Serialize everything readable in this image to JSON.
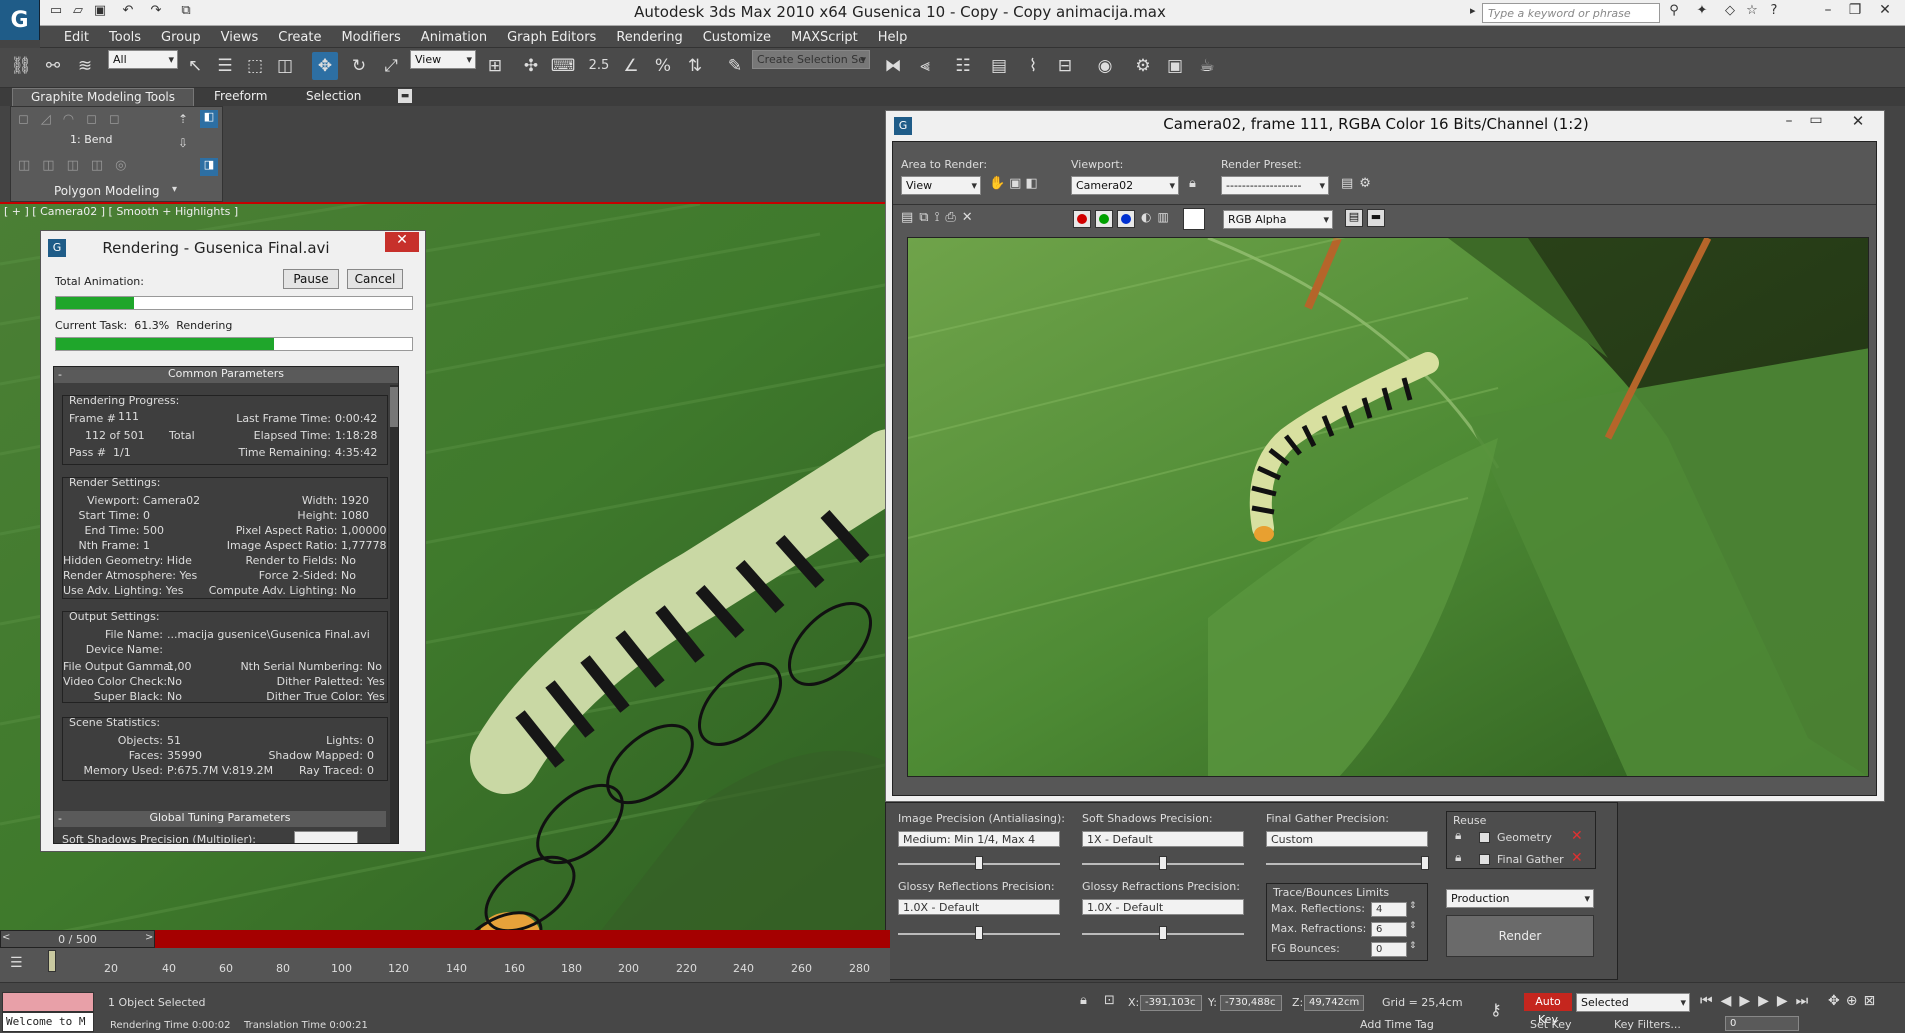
{
  "app": {
    "title": "Autodesk 3ds Max  2010 x64      Gusenica 10 - Copy - Copy animacija.max",
    "logo": "G",
    "search_placeholder": "Type a keyword or phrase"
  },
  "menu": [
    "Edit",
    "Tools",
    "Group",
    "Views",
    "Create",
    "Modifiers",
    "Animation",
    "Graph Editors",
    "Rendering",
    "Customize",
    "MAXScript",
    "Help"
  ],
  "toolbar": {
    "filter": "All",
    "ref_coord": "View",
    "snap_label": "2.5",
    "named_selection": "Create Selection Se"
  },
  "ribbon": {
    "tabs": [
      "Graphite Modeling Tools",
      "Freeform",
      "Selection"
    ],
    "modifier": "1: Bend",
    "group": "Polygon Modeling"
  },
  "viewport": {
    "label": "[ + ] [ Camera02 ] [ Smooth + Highlights ]"
  },
  "render_dialog": {
    "title": "Rendering - Gusenica Final.avi",
    "pause": "Pause",
    "cancel": "Cancel",
    "total_label": "Total Animation:",
    "total_progress": 0.22,
    "current_label": "Current Task:",
    "current_percent": "61.3%",
    "current_status": "Rendering",
    "current_progress": 0.613,
    "rollout1": "Common Parameters",
    "rollout2": "Global Tuning Parameters",
    "cutoff_text": "Soft Shadows Precision (Multiplier):",
    "progress": {
      "caption": "Rendering Progress:",
      "frame_label": "Frame #",
      "frame": "111",
      "of_label": "112 of 501",
      "total": "Total",
      "pass_label": "Pass #",
      "pass": "1/1",
      "last_label": "Last Frame Time:",
      "last": "0:00:42",
      "elapsed_label": "Elapsed Time:",
      "elapsed": "1:18:28",
      "remaining_label": "Time Remaining:",
      "remaining": "4:35:42"
    },
    "settings": {
      "caption": "Render Settings:",
      "left": [
        [
          "Viewport:",
          "Camera02"
        ],
        [
          "Start Time:",
          "0"
        ],
        [
          "End Time:",
          "500"
        ],
        [
          "Nth Frame:",
          "1"
        ],
        [
          "Hidden Geometry:",
          "Hide"
        ],
        [
          "Render Atmosphere:",
          "Yes"
        ],
        [
          "Use Adv. Lighting:",
          "Yes"
        ]
      ],
      "right": [
        [
          "Width:",
          "1920"
        ],
        [
          "Height:",
          "1080"
        ],
        [
          "Pixel Aspect Ratio:",
          "1,00000"
        ],
        [
          "Image Aspect Ratio:",
          "1,77778"
        ],
        [
          "Render to Fields:",
          "No"
        ],
        [
          "Force 2-Sided:",
          "No"
        ],
        [
          "Compute Adv. Lighting:",
          "No"
        ]
      ]
    },
    "output": {
      "caption": "Output Settings:",
      "file_label": "File Name:",
      "file": "...macija gusenice\\Gusenica Final.avi",
      "device_label": "Device Name:",
      "device": "",
      "rows": [
        [
          "File Output Gamma:",
          "1,00",
          "Nth Serial Numbering:",
          "No"
        ],
        [
          "Video Color Check:",
          "No",
          "Dither Paletted:",
          "Yes"
        ],
        [
          "Super Black:",
          "No",
          "Dither True Color:",
          "Yes"
        ]
      ]
    },
    "stats": {
      "caption": "Scene Statistics:",
      "rows": [
        [
          "Objects:",
          "51",
          "Lights:",
          "0"
        ],
        [
          "Faces:",
          "35990",
          "Shadow Mapped:",
          "0"
        ],
        [
          "Memory Used:",
          "P:675.7M V:819.2M",
          "Ray Traced:",
          "0"
        ]
      ]
    }
  },
  "fb": {
    "title": "Camera02, frame 111, RGBA Color 16 Bits/Channel (1:2)",
    "area_label": "Area to Render:",
    "area": "View",
    "viewport_label": "Viewport:",
    "viewport": "Camera02",
    "preset_label": "Render Preset:",
    "preset": "-------------------",
    "channel": "RGB Alpha"
  },
  "lower": {
    "image_precision_label": "Image Precision (Antialiasing):",
    "image_precision": "Medium: Min 1/4, Max 4",
    "image_precision_pos": 0.5,
    "soft_shadows_label": "Soft Shadows Precision:",
    "soft_shadows": "1X - Default",
    "soft_shadows_pos": 0.5,
    "fg_precision_label": "Final Gather Precision:",
    "fg_precision": "Custom",
    "fg_precision_pos": 0.98,
    "glossy_refl_label": "Glossy Reflections Precision:",
    "glossy_refl": "1.0X - Default",
    "glossy_refl_pos": 0.5,
    "glossy_refr_label": "Glossy Refractions Precision:",
    "glossy_refr": "1.0X - Default",
    "glossy_refr_pos": 0.5,
    "trace_label": "Trace/Bounces Limits",
    "max_refl_label": "Max. Reflections:",
    "max_refl": "4",
    "max_refr_label": "Max. Refractions:",
    "max_refr": "6",
    "fg_bounces_label": "FG Bounces:",
    "fg_bounces": "0",
    "reuse_label": "Reuse",
    "geometry": "Geometry",
    "final_gather": "Final Gather",
    "mode": "Production",
    "render": "Render"
  },
  "timeline": {
    "slider": "0 / 500",
    "ticks": [
      "20",
      "40",
      "60",
      "80",
      "100",
      "120",
      "140",
      "160",
      "180",
      "200",
      "220",
      "240",
      "260",
      "280"
    ]
  },
  "status": {
    "welcome": "Welcome to M",
    "selected": "1 Object Selected",
    "render_time": "Rendering Time  0:00:02",
    "translation_time": "Translation Time  0:00:21",
    "x_label": "X:",
    "x": "-391,103c",
    "y_label": "Y:",
    "y": "-730,488c",
    "z_label": "Z:",
    "z": "49,742cm",
    "grid": "Grid = 25,4cm",
    "add_time_tag": "Add Time Tag",
    "auto_key": "Auto Key",
    "set_key": "Set Key",
    "selected_dd": "Selected",
    "key_filters": "Key Filters...",
    "frame": "0"
  }
}
